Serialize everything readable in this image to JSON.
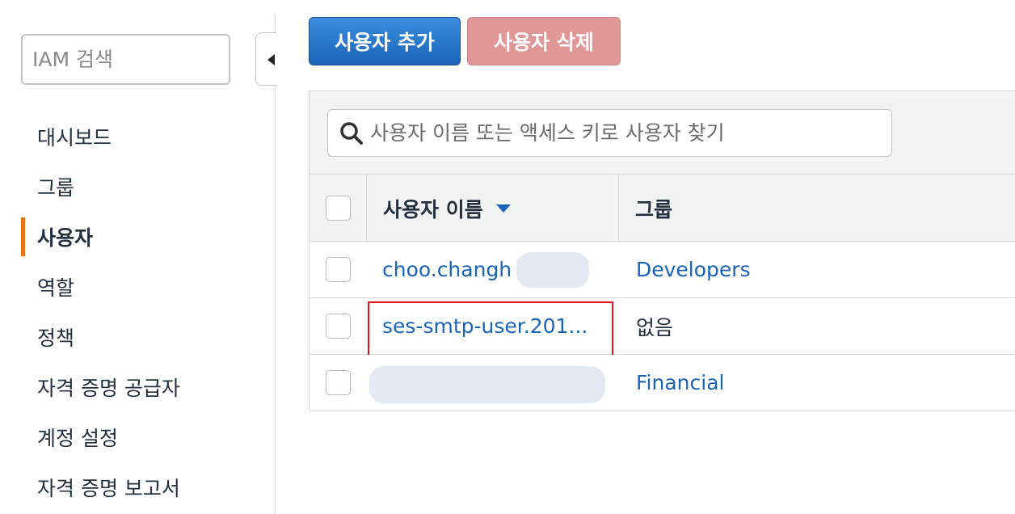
{
  "sidebar": {
    "search_placeholder": "IAM 검색",
    "items": [
      {
        "label": "대시보드",
        "active": false
      },
      {
        "label": "그룹",
        "active": false
      },
      {
        "label": "사용자",
        "active": true
      },
      {
        "label": "역할",
        "active": false
      },
      {
        "label": "정책",
        "active": false
      },
      {
        "label": "자격 증명 공급자",
        "active": false
      },
      {
        "label": "계정 설정",
        "active": false
      },
      {
        "label": "자격 증명 보고서",
        "active": false
      }
    ],
    "accent_color": "#ec7211"
  },
  "toolbar": {
    "add_user_label": "사용자 추가",
    "delete_user_label": "사용자 삭제"
  },
  "filter": {
    "placeholder": "사용자 이름 또는 액세스 키로 사용자 찾기"
  },
  "table": {
    "columns": [
      "사용자 이름",
      "그룹"
    ],
    "rows": [
      {
        "username": "choo.changh",
        "group": "Developers"
      },
      {
        "username": "ses-smtp-user.201...",
        "group": "없음"
      },
      {
        "username": "",
        "group": "Financial"
      }
    ]
  },
  "colors": {
    "link": "#1a64b8",
    "primary_button": "#1a64b8",
    "danger_button": "#e09797",
    "highlight": "#e8101c"
  }
}
